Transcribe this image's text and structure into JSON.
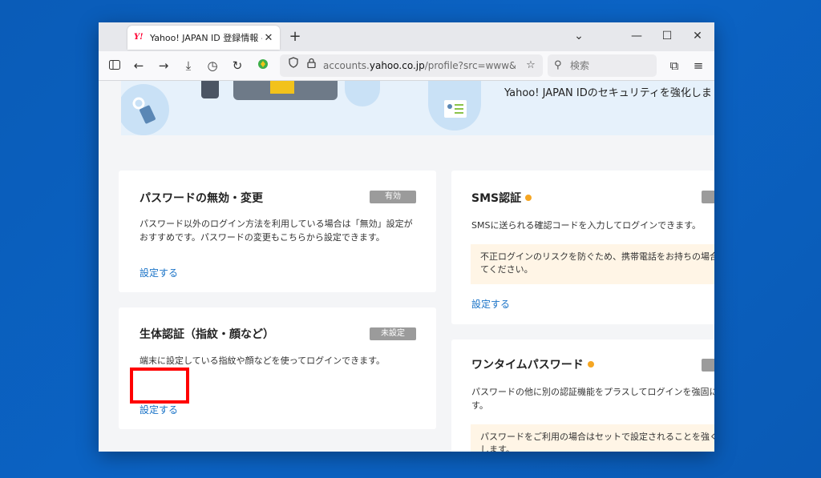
{
  "browser": {
    "tab_title": "Yahoo! JAPAN ID 登録情報 - Yahoo",
    "tab_favicon": "Y!",
    "new_tab_label": "+",
    "url_prefix": "accounts.",
    "url_domain": "yahoo.co.jp",
    "url_suffix": "/profile?src=www&done=",
    "search_placeholder": "検索"
  },
  "hero": {
    "text": "Yahoo! JAPAN IDのセキュリティを強化しま"
  },
  "cards": {
    "password": {
      "title": "パスワードの無効・変更",
      "badge": "有効",
      "desc_line1": "パスワード以外のログイン方法を利用している場合は「無効」設定が",
      "desc_line2": "おすすめです。パスワードの変更もこちらから設定できます。",
      "link": "設定する"
    },
    "biometric": {
      "title": "生体認証（指紋・顔など）",
      "badge": "未設定",
      "desc": "端末に設定している指紋や顔などを使ってログインできます。",
      "link": "設定する"
    },
    "sms": {
      "title": "SMS認証",
      "desc": "SMSに送られる確認コードを入力してログインできます。",
      "notice_line1": "不正ログインのリスクを防ぐため、携帯電話をお持ちの場合は設",
      "notice_line2": "てください。",
      "link": "設定する"
    },
    "onetime": {
      "title": "ワンタイムパスワード",
      "desc_line1": "パスワードの他に別の認証機能をプラスしてログインを強固に",
      "desc_line2": "す。",
      "notice_line1": "パスワードをご利用の場合はセットで設定されることを強くおす",
      "notice_line2": "します。"
    }
  },
  "colors": {
    "desktop": "#0b63c4",
    "link": "#1a73c7",
    "badge": "#9b9b9b",
    "status_dot": "#f5a623",
    "notice_bg": "#fff5e6",
    "highlight": "#ff0000"
  }
}
